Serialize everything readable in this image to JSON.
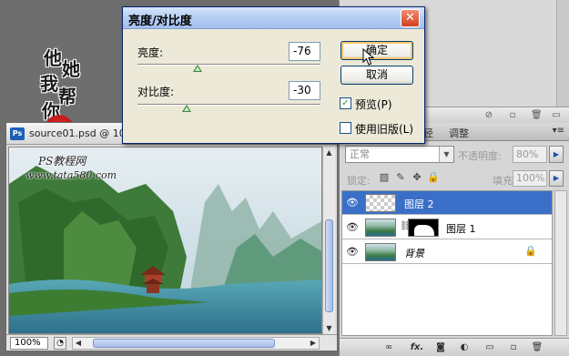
{
  "dialog": {
    "title": "亮度/对比度",
    "brightness": {
      "label": "亮度:",
      "value": "-76",
      "slider_fraction": 0.33
    },
    "contrast": {
      "label": "对比度:",
      "value": "-30",
      "slider_fraction": 0.27
    },
    "ok_label": "确定",
    "cancel_label": "取消",
    "preview_label": "预览(P)",
    "preview_checked": true,
    "legacy_label": "使用旧版(L)",
    "legacy_checked": false
  },
  "document": {
    "title": "source01.psd @ 10",
    "zoom": "100%",
    "watermark_line1": "PS教程网",
    "watermark_line2": "www.tata580.com"
  },
  "watermark_chars": [
    "他",
    "她",
    "我",
    "帮",
    "你"
  ],
  "layers_panel": {
    "tabs": [
      "径",
      "调整"
    ],
    "blend_mode": "正常",
    "opacity_label": "不透明度:",
    "opacity_value": "80%",
    "lock_label": "锁定:",
    "fill_label": "填充:",
    "fill_value": "100%",
    "layers": [
      {
        "name": "图层 2",
        "selected": true,
        "thumb": "transparent"
      },
      {
        "name": "图层 1",
        "selected": false,
        "thumb": "scene",
        "has_mask": true
      },
      {
        "name": "背景",
        "selected": false,
        "thumb": "scene",
        "locked": true
      }
    ]
  },
  "colors": {
    "selection": "#3a6fc7",
    "dialog_bg": "#ece9d8",
    "close_button": "#d2411f"
  }
}
